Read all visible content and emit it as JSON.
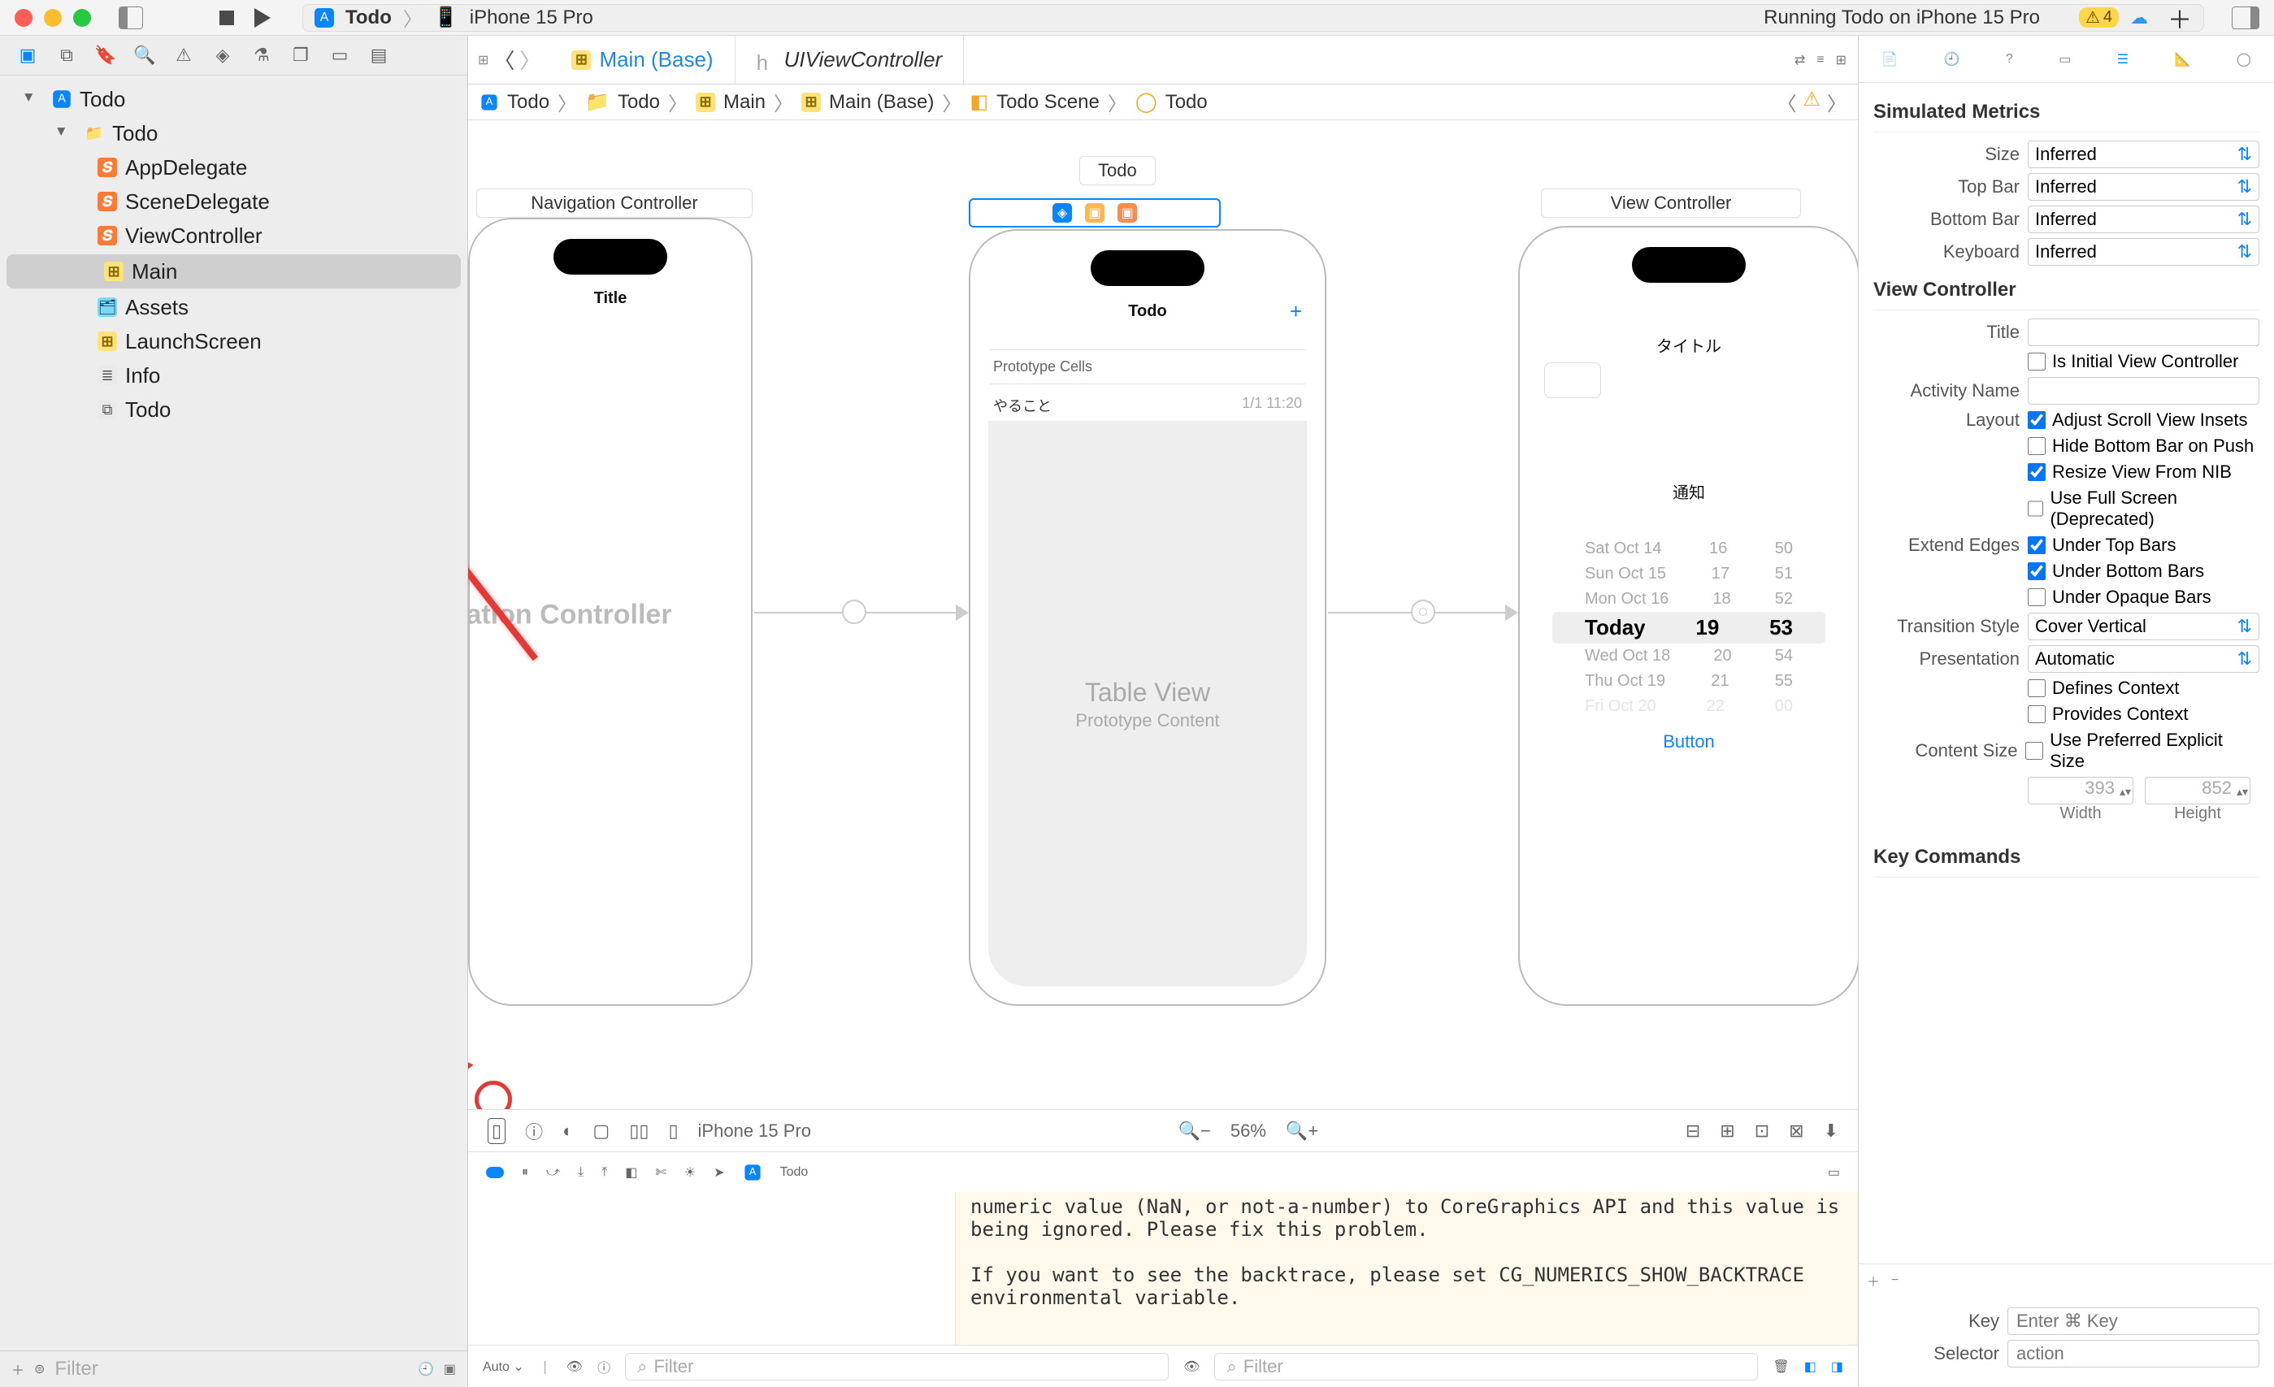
{
  "titlebar": {
    "scheme": "Todo",
    "device": "iPhone 15 Pro",
    "status": "Running Todo on iPhone 15 Pro",
    "warnings": "4"
  },
  "navigator_icons": [
    "folder",
    "repo",
    "bookmark",
    "search",
    "warning",
    "tag",
    "flask",
    "spray",
    "rect",
    "sidebar"
  ],
  "tree": {
    "project": "Todo",
    "group": "Todo",
    "items": [
      "AppDelegate",
      "SceneDelegate",
      "ViewController",
      "Main",
      "Assets",
      "LaunchScreen",
      "Info",
      "Todo"
    ]
  },
  "left_filter_placeholder": "Filter",
  "tabs": {
    "active": "Main (Base)",
    "second": "UIViewController"
  },
  "crumbs": [
    "Todo",
    "Todo",
    "Main",
    "Main (Base)",
    "Todo Scene",
    "Todo"
  ],
  "canvas": {
    "scene1": "Navigation Controller",
    "navtitle": "Title",
    "navlabel": "avigation Controller",
    "tableview": "Table View",
    "proto": "Prototype Content",
    "scene2": "Todo",
    "scene2_header": "Todo",
    "proto_header": "Prototype Cells",
    "cell_left": "やること",
    "cell_right": "1/1 11:20",
    "scene3": "View Controller",
    "s3_title": "タイトル",
    "s3_notice": "通知",
    "picker": [
      {
        "d": "Sat Oct 14",
        "h": "16",
        "m": "50"
      },
      {
        "d": "Sun Oct 15",
        "h": "17",
        "m": "51"
      },
      {
        "d": "Mon Oct 16",
        "h": "18",
        "m": "52"
      },
      {
        "d": "Today",
        "h": "19",
        "m": "53"
      },
      {
        "d": "Wed Oct 18",
        "h": "20",
        "m": "54"
      },
      {
        "d": "Thu Oct 19",
        "h": "21",
        "m": "55"
      },
      {
        "d": "Fri Oct 20",
        "h": "22",
        "m": "00"
      }
    ],
    "s3_button": "Button"
  },
  "canvas_device": "iPhone 15 Pro",
  "zoom": "56%",
  "debug_target": "Todo",
  "console_text": "numeric value (NaN, or not-a-number) to CoreGraphics API and this value is being ignored. Please fix this problem.\n\nIf you want to see the backtrace, please set CG_NUMERICS_SHOW_BACKTRACE environmental variable.",
  "console_left_mode": "Auto",
  "console_filter": "Filter",
  "inspector": {
    "sim_metrics": "Simulated Metrics",
    "size": "Inferred",
    "topbar": "Inferred",
    "bottombar": "Inferred",
    "keyboard": "Inferred",
    "vc_section": "View Controller",
    "title": "",
    "is_initial": "Is Initial View Controller",
    "activity": "",
    "layout": "Layout",
    "adjust": "Adjust Scroll View Insets",
    "hidebar": "Hide Bottom Bar on Push",
    "resize": "Resize View From NIB",
    "fullscreen": "Use Full Screen (Deprecated)",
    "extend": "Extend Edges",
    "under_top": "Under Top Bars",
    "under_bottom": "Under Bottom Bars",
    "under_opaque": "Under Opaque Bars",
    "transition": "Cover Vertical",
    "presentation": "Automatic",
    "defines": "Defines Context",
    "provides": "Provides Context",
    "content_size": "Content Size",
    "preferred": "Use Preferred Explicit Size",
    "width": "393",
    "height": "852",
    "width_lbl": "Width",
    "height_lbl": "Height",
    "keycmds": "Key Commands",
    "key_ph": "Enter ⌘ Key",
    "selector_ph": "action",
    "labels": {
      "size": "Size",
      "topbar": "Top Bar",
      "bottombar": "Bottom Bar",
      "keyboard": "Keyboard",
      "title": "Title",
      "activity": "Activity Name",
      "transition": "Transition Style",
      "presentation": "Presentation",
      "key": "Key",
      "selector": "Selector"
    }
  }
}
